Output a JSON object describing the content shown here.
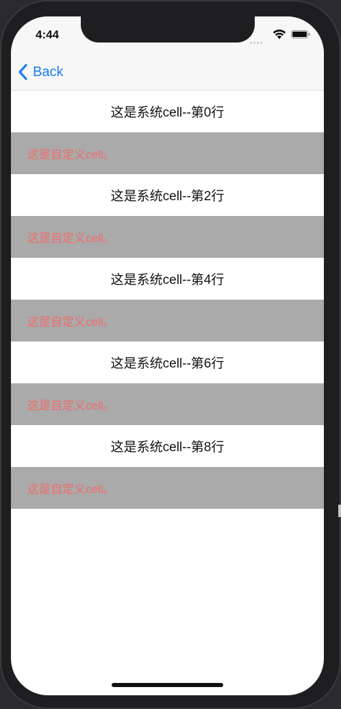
{
  "status_bar": {
    "time": "4:44",
    "icons": [
      "signal-dots-icon",
      "wifi-icon",
      "battery-icon"
    ]
  },
  "nav": {
    "back_label": "Back",
    "back_icon": "chevron-left-icon",
    "accent_color": "#1a7cf0"
  },
  "rows": [
    {
      "type": "system",
      "text": "这是系统cell--第0行"
    },
    {
      "type": "custom",
      "text": "这是自定义cell。"
    },
    {
      "type": "system",
      "text": "这是系统cell--第2行"
    },
    {
      "type": "custom",
      "text": "这是自定义cell。"
    },
    {
      "type": "system",
      "text": "这是系统cell--第4行"
    },
    {
      "type": "custom",
      "text": "这是自定义cell。"
    },
    {
      "type": "system",
      "text": "这是系统cell--第6行"
    },
    {
      "type": "custom",
      "text": "这是自定义cell。"
    },
    {
      "type": "system",
      "text": "这是系统cell--第8行"
    },
    {
      "type": "custom",
      "text": "这是自定义cell。"
    }
  ],
  "colors": {
    "custom_row_background": "#aaaaaa",
    "custom_row_text": "#f26b6b",
    "system_row_background": "#ffffff",
    "system_row_text": "#111111"
  }
}
